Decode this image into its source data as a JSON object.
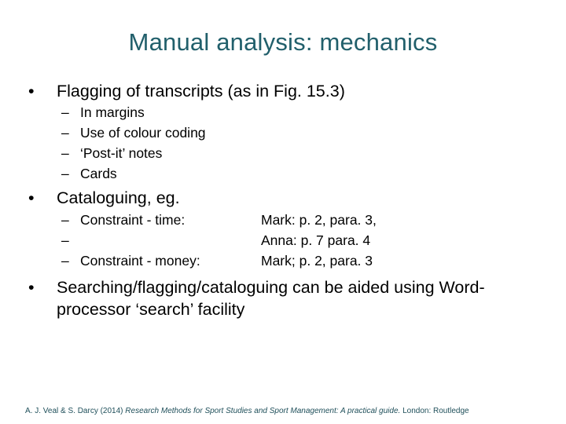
{
  "slide": {
    "title": "Manual analysis: mechanics",
    "theme_color": "#215f6b",
    "bullets": [
      {
        "text": "Flagging of transcripts (as in Fig. 15.3)",
        "subitems": [
          "In margins",
          "Use of colour coding",
          "‘Post-it’ notes",
          "Cards"
        ]
      },
      {
        "text": "Cataloguing, eg.",
        "subitems": [
          {
            "label": "Constraint - time:",
            "ref": "Mark: p. 2, para. 3,"
          },
          {
            "label": "",
            "ref": "Anna: p. 7 para. 4"
          },
          {
            "label": "Constraint - money:",
            "ref": "Mark; p. 2, para. 3"
          }
        ]
      },
      {
        "line1": "Searching/flagging/cataloguing can be aided using Word-",
        "line2": "processor ‘search’ facility"
      }
    ],
    "bullet_glyph": "•",
    "dash_glyph": "–",
    "citation": {
      "authors": "A. J. Veal & S. Darcy (2014)",
      "book_title": "Research Methods for Sport Studies and Sport Management: A practical guide.",
      "publisher": "London: Routledge"
    }
  }
}
